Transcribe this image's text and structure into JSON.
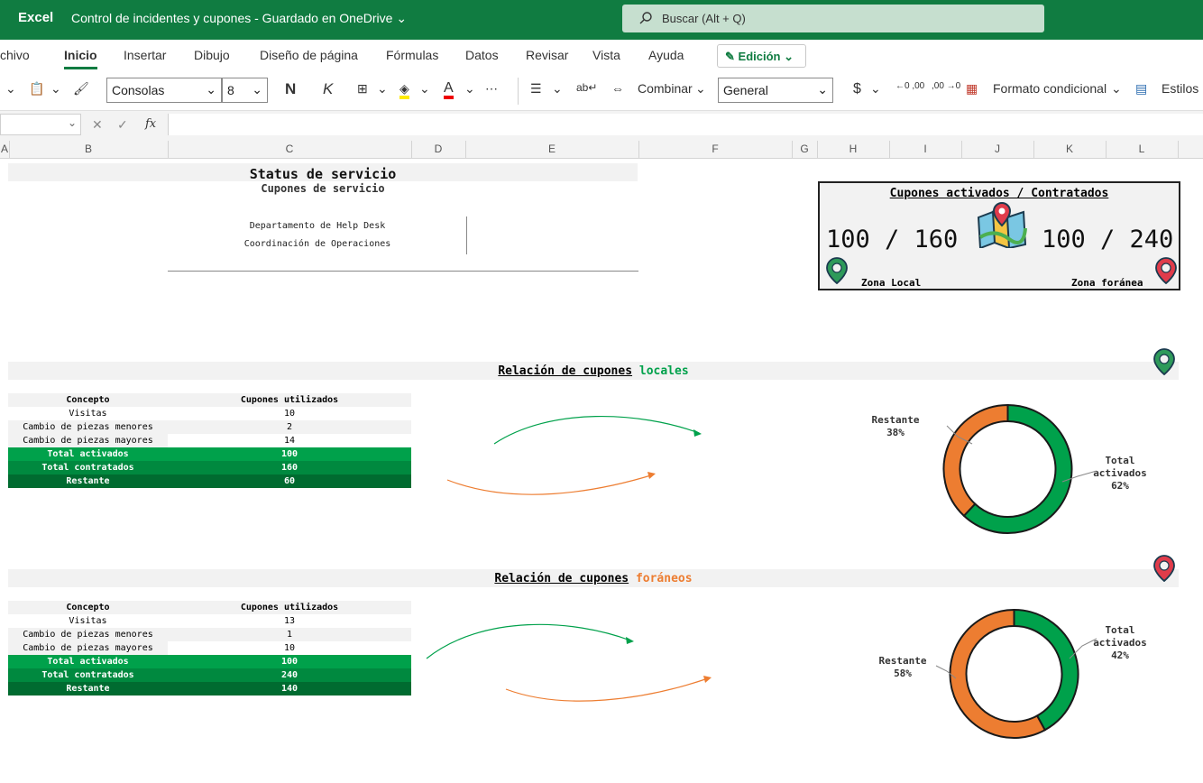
{
  "titlebar": {
    "app": "Excel",
    "doc": "Control de incidentes y cupones  -  Guardado en OneDrive",
    "search_placeholder": "Buscar (Alt + Q)"
  },
  "tabs": [
    "chivo",
    "Inicio",
    "Insertar",
    "Dibujo",
    "Diseño de página",
    "Fórmulas",
    "Datos",
    "Revisar",
    "Vista",
    "Ayuda"
  ],
  "edicion": "Edición",
  "toolbar": {
    "font": "Consolas",
    "size": "8",
    "bold": "N",
    "italic": "K",
    "combinar": "Combinar",
    "number_format": "General",
    "currency": "$",
    "formato_condicional": "Formato condicional",
    "estilos": "Estilos"
  },
  "formula": {
    "fx": "fx"
  },
  "columns": [
    "A",
    "B",
    "C",
    "D",
    "E",
    "F",
    "G",
    "H",
    "I",
    "J",
    "K",
    "L"
  ],
  "header": {
    "title": "Status de servicio",
    "subtitle": "Cupones de servicio",
    "dept": "Departamento de Help Desk",
    "coord": "Coordinación de Operaciones"
  },
  "card": {
    "title": "Cupones activados / Contratados",
    "local_value": "100 / 160",
    "foreign_value": "100 / 240",
    "local_label": "Zona Local",
    "foreign_label": "Zona foránea",
    "colors": {
      "local": "#2e9a5a",
      "foreign": "#e03c4b"
    }
  },
  "local": {
    "heading": "Relación de cupones",
    "heading_word": "locales",
    "heading_color": "#00a14b",
    "col_concept": "Concepto",
    "col_used": "Cupones utilizados",
    "rows": [
      {
        "concept": "Visitas",
        "value": "10"
      },
      {
        "concept": "Cambio de piezas menores",
        "value": "2"
      },
      {
        "concept": "Cambio de piezas mayores",
        "value": "14"
      }
    ],
    "totals": [
      {
        "concept": "Total activados",
        "value": "100"
      },
      {
        "concept": "Total contratados",
        "value": "160"
      },
      {
        "concept": "Restante",
        "value": "60"
      }
    ],
    "donut": {
      "restante_label": "Restante",
      "restante_pct": "38%",
      "activados_label": "Total activados",
      "activados_pct": "62%",
      "activados": 62,
      "restante": 38
    }
  },
  "foreign": {
    "heading": "Relación de cupones",
    "heading_word": "foráneos",
    "heading_color": "#ed7d31",
    "col_concept": "Concepto",
    "col_used": "Cupones utilizados",
    "rows": [
      {
        "concept": "Visitas",
        "value": "13"
      },
      {
        "concept": "Cambio de piezas menores",
        "value": "1"
      },
      {
        "concept": "Cambio de piezas mayores",
        "value": "10"
      }
    ],
    "totals": [
      {
        "concept": "Total activados",
        "value": "100"
      },
      {
        "concept": "Total contratados",
        "value": "240"
      },
      {
        "concept": "Restante",
        "value": "140"
      }
    ],
    "donut": {
      "restante_label": "Restante",
      "restante_pct": "58%",
      "activados_label": "Total activados",
      "activados_pct": "42%",
      "activados": 42,
      "restante": 58
    }
  },
  "chart_colors": {
    "activados": "#00a14b",
    "restante": "#ed7d31"
  }
}
